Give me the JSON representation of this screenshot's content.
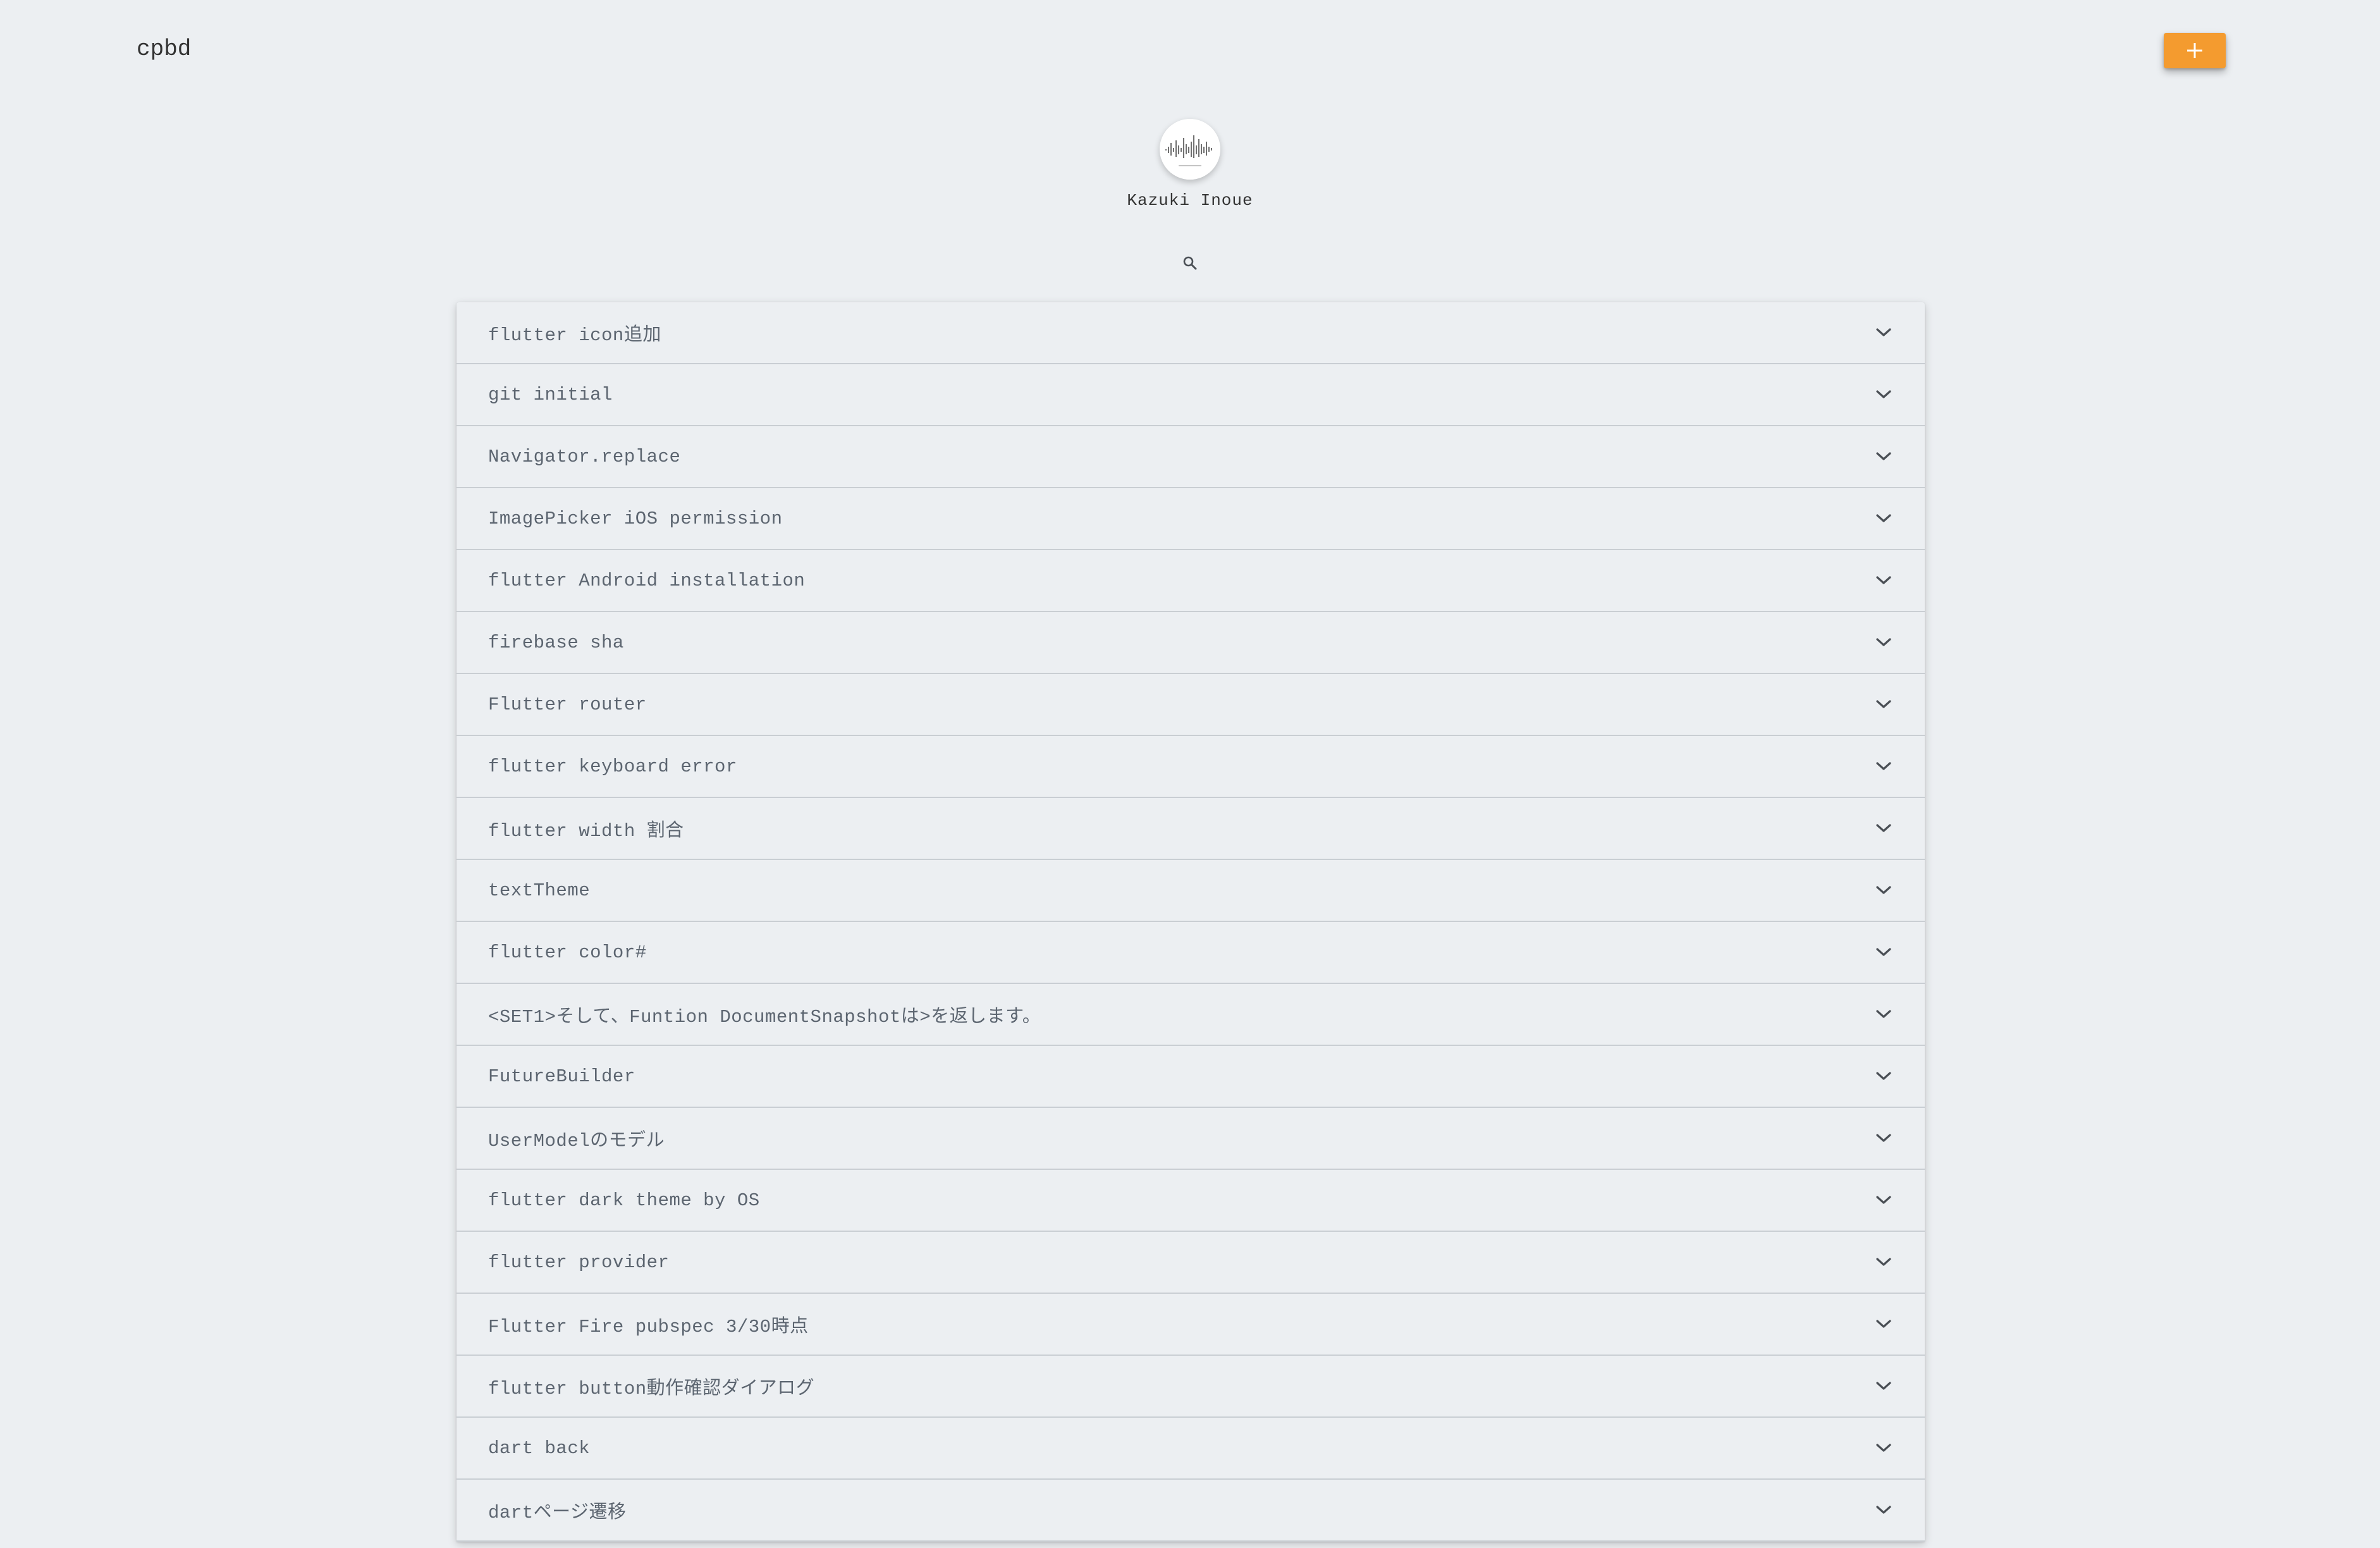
{
  "header": {
    "app_title": "cpbd",
    "add_label": "+",
    "accent_color": "#f49b2f"
  },
  "profile": {
    "name": "Kazuki Inoue",
    "avatar_icon": "waveform-avatar"
  },
  "search": {
    "icon": "search-icon"
  },
  "entries": [
    {
      "title": "flutter icon追加"
    },
    {
      "title": "git initial"
    },
    {
      "title": "Navigator.replace"
    },
    {
      "title": "ImagePicker iOS permission"
    },
    {
      "title": "flutter Android installation"
    },
    {
      "title": "firebase sha"
    },
    {
      "title": "Flutter router"
    },
    {
      "title": "flutter keyboard error"
    },
    {
      "title": "flutter width 割合"
    },
    {
      "title": "textTheme"
    },
    {
      "title": "flutter color#"
    },
    {
      "title": "<SET1>そして、Funtion DocumentSnapshotは>を返します。"
    },
    {
      "title": "FutureBuilder"
    },
    {
      "title": "UserModelのモデル"
    },
    {
      "title": "flutter dark theme by OS"
    },
    {
      "title": "flutter provider"
    },
    {
      "title": "Flutter Fire pubspec 3/30時点"
    },
    {
      "title": "flutter button動作確認ダイアログ"
    },
    {
      "title": "dart back"
    },
    {
      "title": "dartページ遷移"
    }
  ]
}
